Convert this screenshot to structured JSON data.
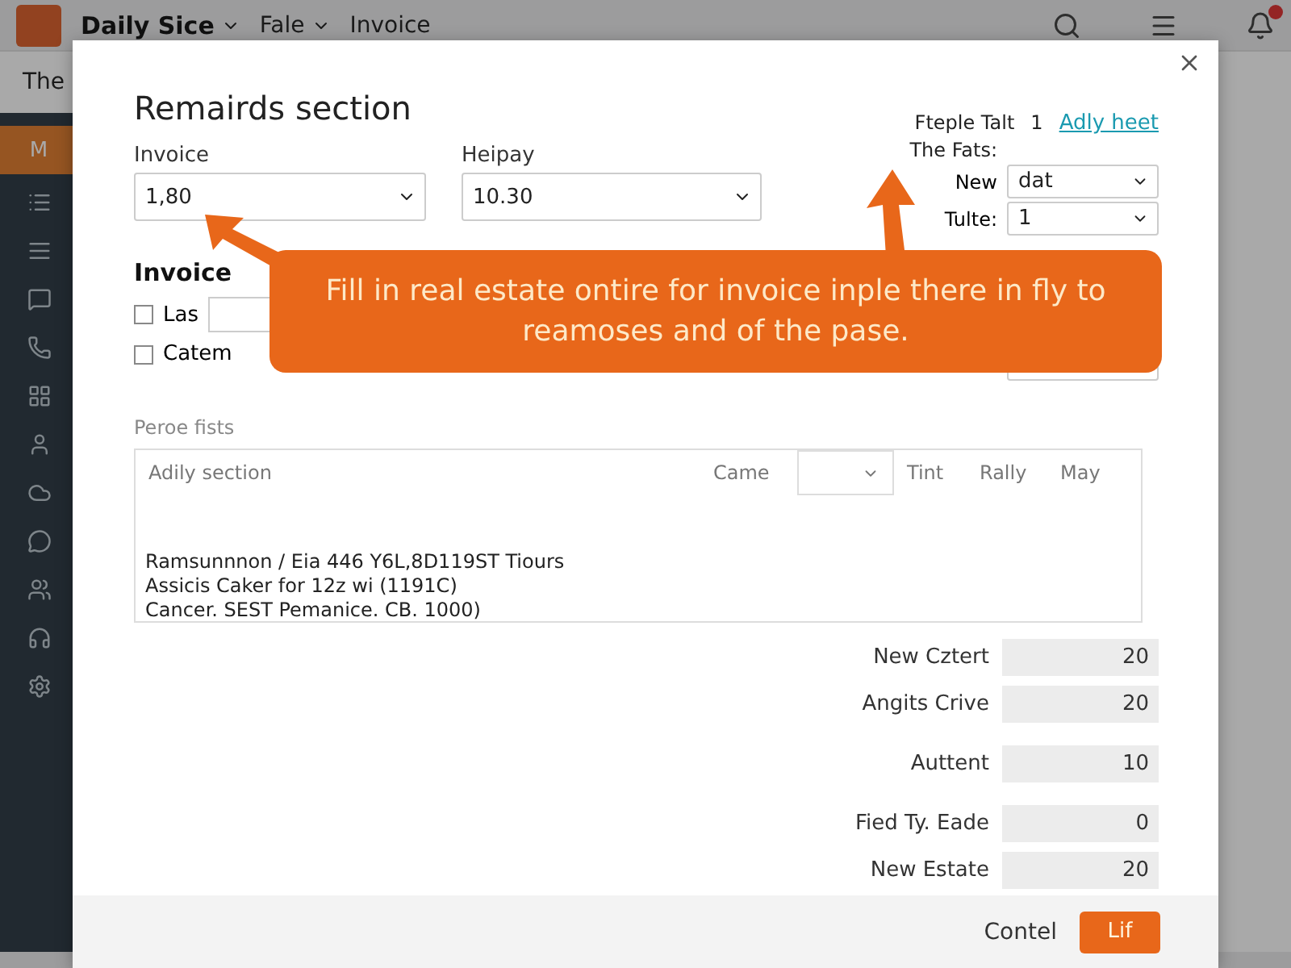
{
  "app": {
    "brand": "Daily Sice",
    "menus": [
      {
        "label": "Fale"
      },
      {
        "label": "Invoice"
      }
    ],
    "subheader": "The"
  },
  "sidebar": {
    "items": [
      {
        "kind": "label",
        "label": "M",
        "selected": true
      },
      {
        "kind": "list",
        "selected": false
      },
      {
        "kind": "menu",
        "selected": false
      },
      {
        "kind": "message",
        "selected": false
      },
      {
        "kind": "phone",
        "selected": false
      },
      {
        "kind": "grid",
        "selected": false
      },
      {
        "kind": "user",
        "selected": false
      },
      {
        "kind": "cloud",
        "selected": false
      },
      {
        "kind": "chat",
        "selected": false
      },
      {
        "kind": "people",
        "selected": false
      },
      {
        "kind": "support",
        "selected": false
      },
      {
        "kind": "settings",
        "selected": false
      }
    ]
  },
  "modal": {
    "title": "Remairds section",
    "fields": [
      {
        "label": "Invoice",
        "value": "1,80"
      },
      {
        "label": "Heipay",
        "value": "10.30"
      }
    ],
    "side": {
      "label": "Fteple Talt",
      "count": "1",
      "link": "Adly heet",
      "subtitle": "The Fats:",
      "selects": [
        {
          "label": "New",
          "value": "dat"
        },
        {
          "label": "Tulte:",
          "value": "1"
        }
      ]
    },
    "invoice": {
      "heading": "Invoice",
      "options": [
        {
          "label": "Las",
          "checked": false
        },
        {
          "label": "Catem",
          "checked": false
        }
      ]
    },
    "callout": "Fill in real estate ontire for invoice inple there in fly to reamoses and of the pase.",
    "table": {
      "caption": "Peroe fists",
      "columns": [
        {
          "kind": "text",
          "label": "Adily section"
        },
        {
          "kind": "text",
          "label": "Came"
        },
        {
          "kind": "dropdown"
        },
        {
          "kind": "text",
          "label": "Tint"
        },
        {
          "kind": "text",
          "label": "Rally"
        },
        {
          "kind": "text",
          "label": "May"
        }
      ],
      "rows": [
        "Ramsunnnon / Eia 446 Y6L,8D119ST Tiours",
        "Assicis Caker for 12z wi (1191C)",
        "Cancer. SEST Pemanice. CB. 1000)"
      ]
    },
    "totals": [
      [
        {
          "label": "New Cztert",
          "value": "20"
        },
        {
          "label": "Angits Crive",
          "value": "20"
        }
      ],
      [
        {
          "label": "Auttent",
          "value": "10"
        }
      ],
      [
        {
          "label": "Fied Ty. Eade",
          "value": "0"
        },
        {
          "label": "New Estate",
          "value": "20"
        }
      ]
    ],
    "footer": {
      "cancel": "Contel",
      "confirm": "Lif"
    }
  }
}
